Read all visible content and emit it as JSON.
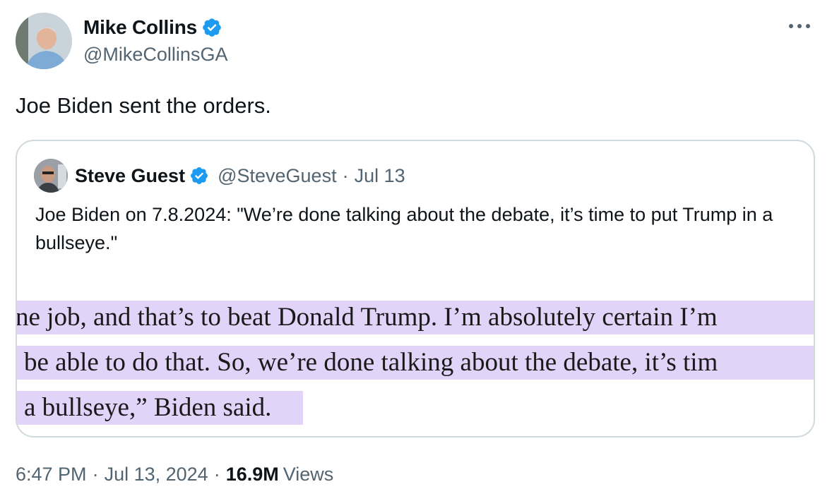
{
  "author": {
    "name": "Mike Collins",
    "handle": "@MikeCollinsGA",
    "verified_icon": "verified-badge-icon",
    "avatar_icon": "avatar-photo"
  },
  "more_icon": "more-options-icon",
  "tweet": {
    "text": "Joe Biden sent the orders."
  },
  "quote": {
    "name": "Steve Guest",
    "handle": "@SteveGuest",
    "separator": "·",
    "date": "Jul 13",
    "text": "Joe Biden on 7.8.2024: \"We’re done talking about the debate, it’s time to put Trump in a bullseye.\"",
    "image": {
      "lines": [
        "ne job, and that’s to beat Donald Trump. I’m absolutely certain I’m",
        "be able to do that. So, we’re done talking about the debate, it’s tim",
        "a bullseye,” Biden said."
      ]
    }
  },
  "meta": {
    "time": "6:47 PM",
    "sep1": "·",
    "date": "Jul 13, 2024",
    "sep2": "·",
    "views_count": "16.9M",
    "views_label": "Views"
  },
  "colors": {
    "accent": "#1d9bf0",
    "highlight": "#e2d4f9",
    "secondary_text": "#536471",
    "border": "#cfd9de"
  }
}
